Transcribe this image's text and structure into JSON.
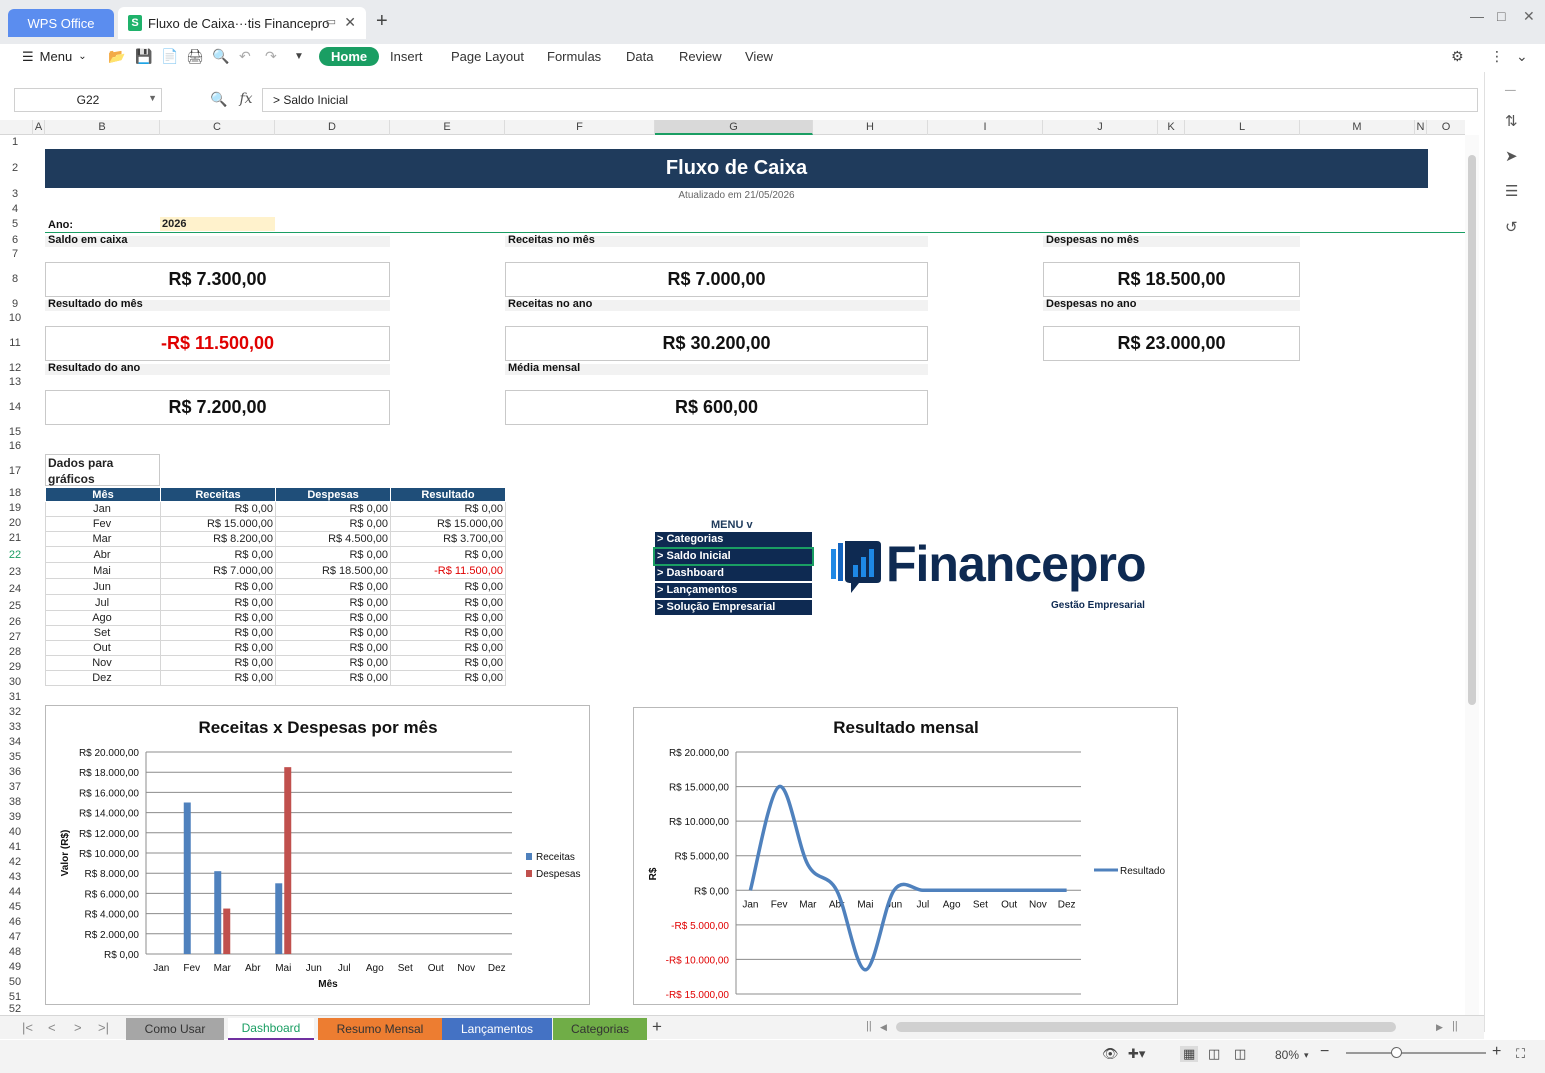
{
  "titlebar": {
    "app_tab": "WPS Office",
    "doc_tab": "Fluxo de Caixa···tis Financepro",
    "s_icon": "S"
  },
  "ribbon": {
    "menu": "Menu",
    "tabs": [
      "Home",
      "Insert",
      "Page Layout",
      "Formulas",
      "Data",
      "Review",
      "View"
    ]
  },
  "formula_bar": {
    "cell_ref": "G22",
    "fx": "fx",
    "content": "> Saldo Inicial"
  },
  "columns": [
    "A",
    "B",
    "C",
    "D",
    "E",
    "F",
    "G",
    "H",
    "I",
    "J",
    "K",
    "L",
    "M",
    "N",
    "O"
  ],
  "rows": [
    "1",
    "2",
    "3",
    "4",
    "5",
    "6",
    "7",
    "8",
    "9",
    "10",
    "11",
    "12",
    "13",
    "14",
    "15",
    "16",
    "17",
    "18",
    "19",
    "20",
    "21",
    "22",
    "23",
    "24",
    "25",
    "26",
    "27",
    "28",
    "29",
    "30",
    "31",
    "32",
    "33",
    "34",
    "35",
    "36",
    "37",
    "38",
    "39",
    "40",
    "41",
    "42",
    "43",
    "44",
    "45",
    "46",
    "47",
    "48",
    "49",
    "50",
    "51",
    "52"
  ],
  "sheet": {
    "title": "Fluxo de Caixa",
    "updated": "Atualizado em 21/05/2026",
    "year_label": "Ano:",
    "year_value": "2026",
    "labels": {
      "saldo": "Saldo em caixa",
      "rec_mes": "Receitas no mês",
      "desp_mes": "Despesas no mês",
      "res_mes": "Resultado do mês",
      "rec_ano": "Receitas no ano",
      "desp_ano": "Despesas no ano",
      "res_ano": "Resultado do ano",
      "media": "Média mensal"
    },
    "values": {
      "saldo": "R$ 7.300,00",
      "rec_mes": "R$ 7.000,00",
      "desp_mes": "R$ 18.500,00",
      "res_mes": "-R$ 11.500,00",
      "rec_ano": "R$ 30.200,00",
      "desp_ano": "R$ 23.000,00",
      "res_ano": "R$ 7.200,00",
      "media": "R$ 600,00"
    },
    "table_title": "Dados para gráficos",
    "table_headers": [
      "Mês",
      "Receitas",
      "Despesas",
      "Resultado"
    ],
    "table_rows": [
      [
        "Jan",
        "R$ 0,00",
        "R$ 0,00",
        "R$ 0,00"
      ],
      [
        "Fev",
        "R$ 15.000,00",
        "R$ 0,00",
        "R$ 15.000,00"
      ],
      [
        "Mar",
        "R$ 8.200,00",
        "R$ 4.500,00",
        "R$ 3.700,00"
      ],
      [
        "Abr",
        "R$ 0,00",
        "R$ 0,00",
        "R$ 0,00"
      ],
      [
        "Mai",
        "R$ 7.000,00",
        "R$ 18.500,00",
        "-R$ 11.500,00"
      ],
      [
        "Jun",
        "R$ 0,00",
        "R$ 0,00",
        "R$ 0,00"
      ],
      [
        "Jul",
        "R$ 0,00",
        "R$ 0,00",
        "R$ 0,00"
      ],
      [
        "Ago",
        "R$ 0,00",
        "R$ 0,00",
        "R$ 0,00"
      ],
      [
        "Set",
        "R$ 0,00",
        "R$ 0,00",
        "R$ 0,00"
      ],
      [
        "Out",
        "R$ 0,00",
        "R$ 0,00",
        "R$ 0,00"
      ],
      [
        "Nov",
        "R$ 0,00",
        "R$ 0,00",
        "R$ 0,00"
      ],
      [
        "Dez",
        "R$ 0,00",
        "R$ 0,00",
        "R$ 0,00"
      ]
    ],
    "menu_title": "MENU v",
    "menu_items": [
      "> Categorias",
      "> Saldo Inicial",
      "> Dashboard",
      "> Lançamentos",
      "> Solução Empresarial"
    ],
    "logo_word": "Financepro",
    "logo_sub": "Gestão Empresarial"
  },
  "chart_data": [
    {
      "type": "bar",
      "title": "Receitas x Despesas por mês",
      "xlabel": "Mês",
      "ylabel": "Valor (R$)",
      "ylim": [
        0,
        20000
      ],
      "yticks": [
        "R$ 0,00",
        "R$ 2.000,00",
        "R$ 4.000,00",
        "R$ 6.000,00",
        "R$ 8.000,00",
        "R$ 10.000,00",
        "R$ 12.000,00",
        "R$ 14.000,00",
        "R$ 16.000,00",
        "R$ 18.000,00",
        "R$ 20.000,00"
      ],
      "categories": [
        "Jan",
        "Fev",
        "Mar",
        "Abr",
        "Mai",
        "Jun",
        "Jul",
        "Ago",
        "Set",
        "Out",
        "Nov",
        "Dez"
      ],
      "series": [
        {
          "name": "Receitas",
          "color": "#4f81bd",
          "values": [
            0,
            15000,
            8200,
            0,
            7000,
            0,
            0,
            0,
            0,
            0,
            0,
            0
          ]
        },
        {
          "name": "Despesas",
          "color": "#c0504d",
          "values": [
            0,
            0,
            4500,
            0,
            18500,
            0,
            0,
            0,
            0,
            0,
            0,
            0
          ]
        }
      ],
      "legend": "right",
      "grid": true
    },
    {
      "type": "line",
      "title": "Resultado mensal",
      "ylabel": "R$",
      "ylim": [
        -15000,
        20000
      ],
      "yticks": [
        "-R$ 15.000,00",
        "-R$ 10.000,00",
        "-R$ 5.000,00",
        "R$ 0,00",
        "R$ 5.000,00",
        "R$ 10.000,00",
        "R$ 15.000,00",
        "R$ 20.000,00"
      ],
      "categories": [
        "Jan",
        "Fev",
        "Mar",
        "Abr",
        "Mai",
        "Jun",
        "Jul",
        "Ago",
        "Set",
        "Out",
        "Nov",
        "Dez"
      ],
      "series": [
        {
          "name": "Resultado",
          "color": "#4f81bd",
          "values": [
            0,
            15000,
            3700,
            0,
            -11500,
            0,
            0,
            0,
            0,
            0,
            0,
            0
          ]
        }
      ],
      "legend": "right",
      "grid": true,
      "smooth": true
    }
  ],
  "sheet_tabs": [
    {
      "label": "Como Usar",
      "bg": "#a6a6a6",
      "fg": "#333333"
    },
    {
      "label": "Dashboard",
      "bg": "#ffffff",
      "fg": "#1a9e63"
    },
    {
      "label": "Resumo Mensal",
      "bg": "#ed7d31",
      "fg": "#333333"
    },
    {
      "label": "Lançamentos",
      "bg": "#4472c4",
      "fg": "#ffffff"
    },
    {
      "label": "Categorias",
      "bg": "#70ad47",
      "fg": "#333333"
    }
  ],
  "statusbar": {
    "zoom": "80%"
  }
}
